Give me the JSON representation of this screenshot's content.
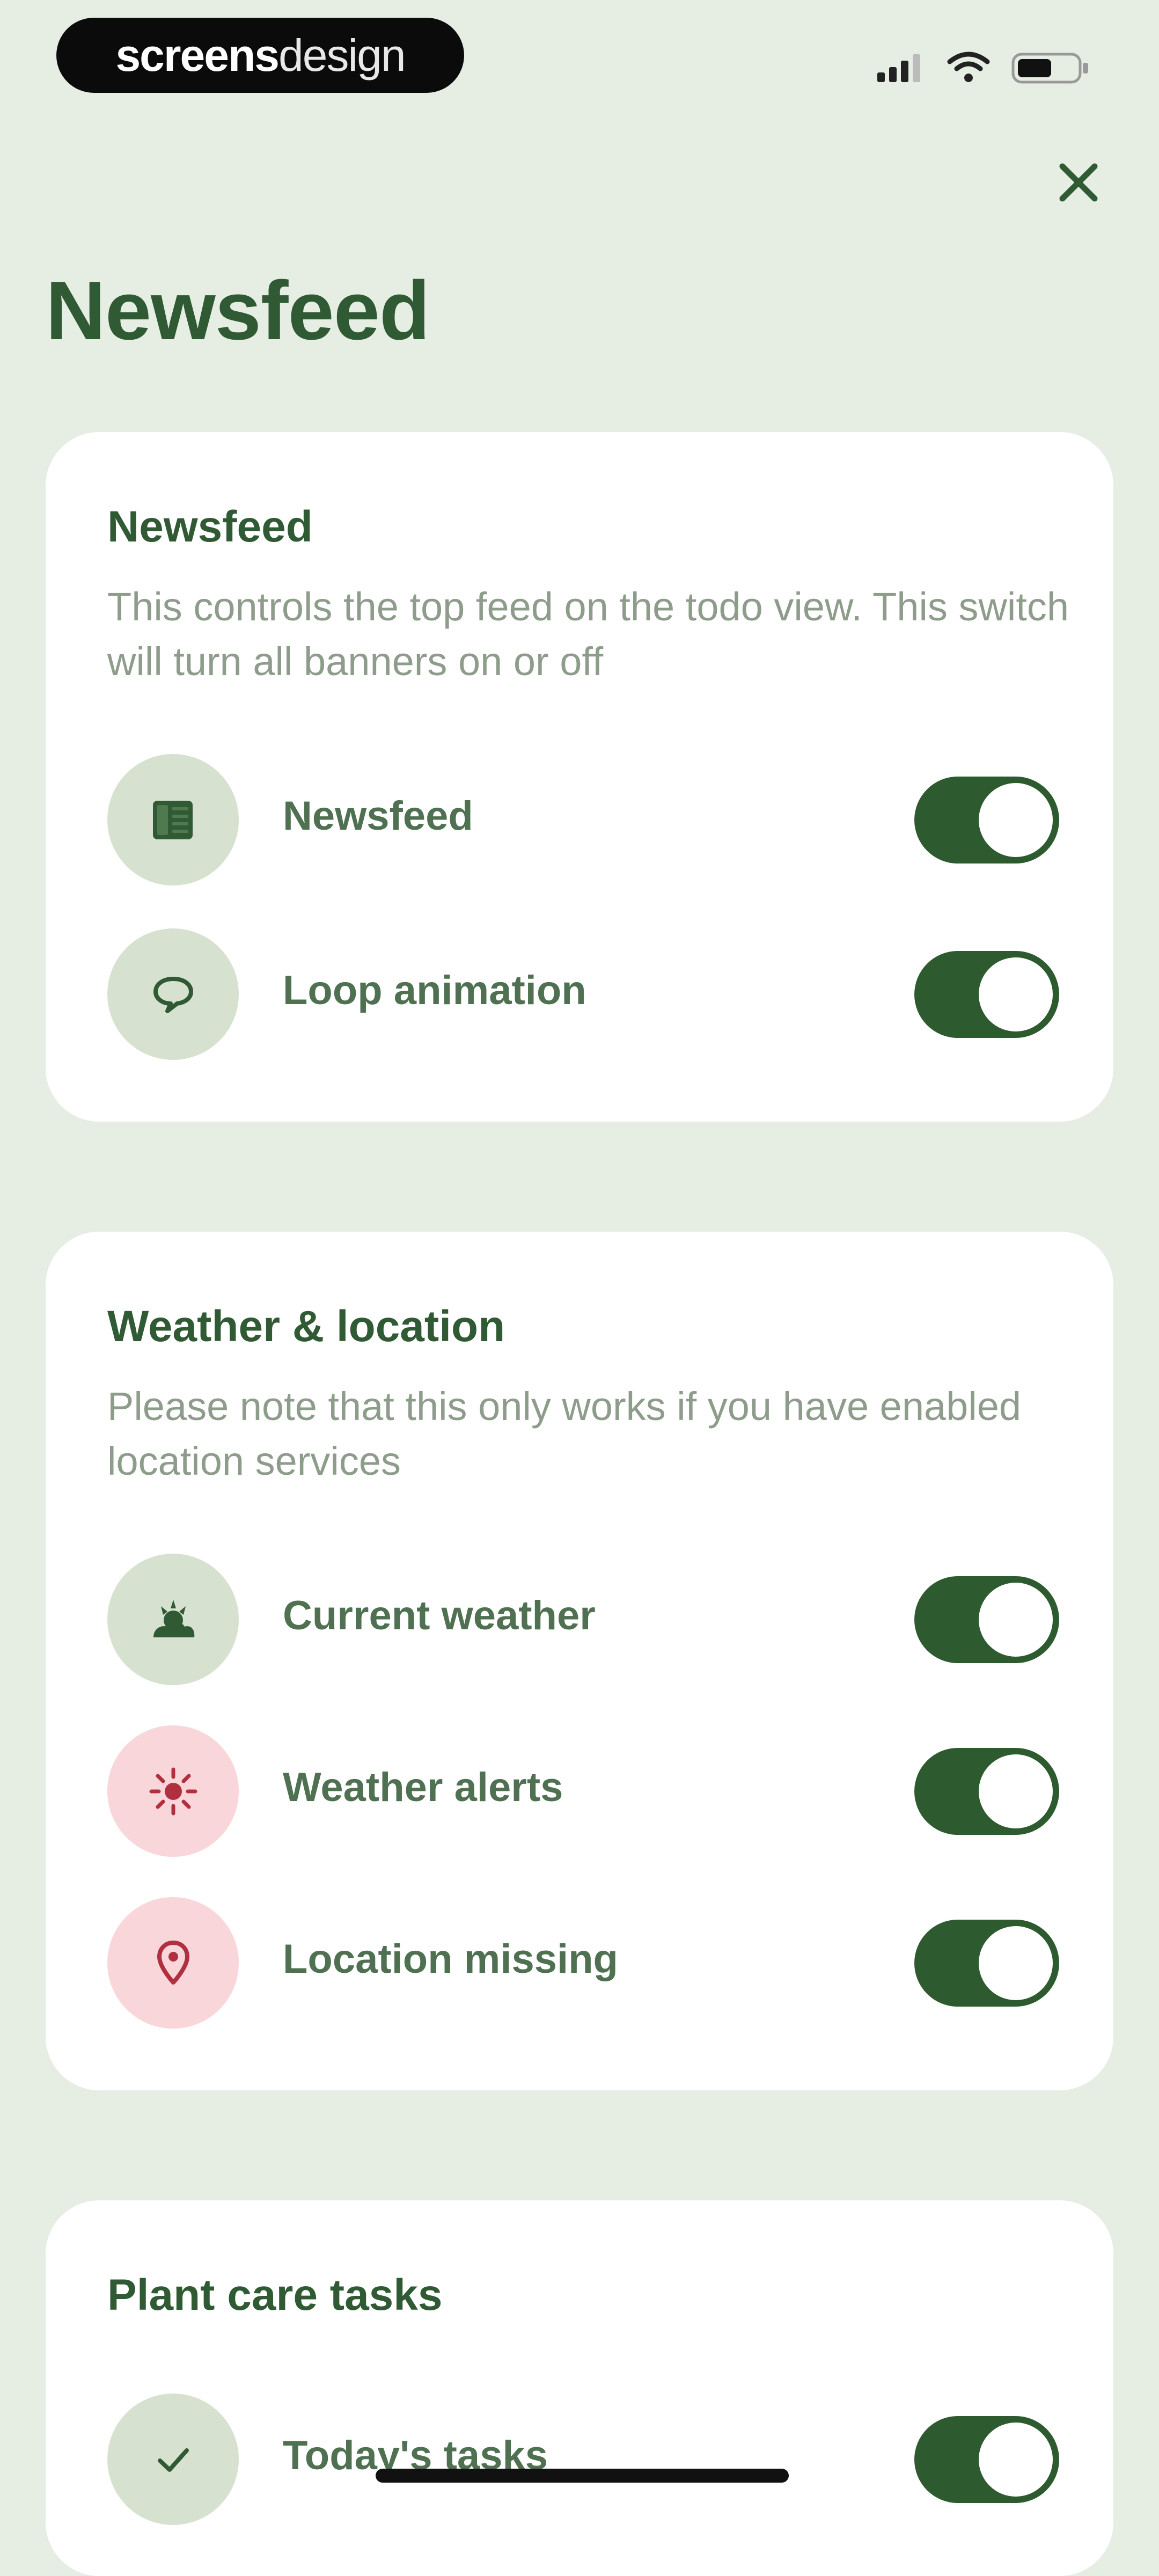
{
  "status_bar": {
    "brand_part1": "screens",
    "brand_part2": "design"
  },
  "page": {
    "title": "Newsfeed",
    "close_icon": "close-icon"
  },
  "colors": {
    "background": "#e6eee3",
    "accent": "#2d5a2e",
    "icon_bg": "#d6e2cf",
    "alert_bg": "#f8d6da",
    "alert_icon": "#b0303f"
  },
  "sections": [
    {
      "title": "Newsfeed",
      "description": "This controls the top feed on the todo view. This switch will turn all banners on or off",
      "items": [
        {
          "label": "Newsfeed",
          "icon": "newspaper-icon",
          "enabled": true
        },
        {
          "label": "Loop animation",
          "icon": "speech-bubble-icon",
          "enabled": true
        }
      ]
    },
    {
      "title": "Weather & location",
      "description": "Please note that this only works if you have enabled location services",
      "items": [
        {
          "label": "Current weather",
          "icon": "weather-icon",
          "enabled": true
        },
        {
          "label": "Weather alerts",
          "icon": "sun-alert-icon",
          "enabled": true
        },
        {
          "label": "Location missing",
          "icon": "location-pin-icon",
          "enabled": true
        }
      ]
    },
    {
      "title": "Plant care tasks",
      "items": [
        {
          "label": "Today's tasks",
          "icon": "checkmark-icon",
          "enabled": true
        }
      ]
    }
  ]
}
